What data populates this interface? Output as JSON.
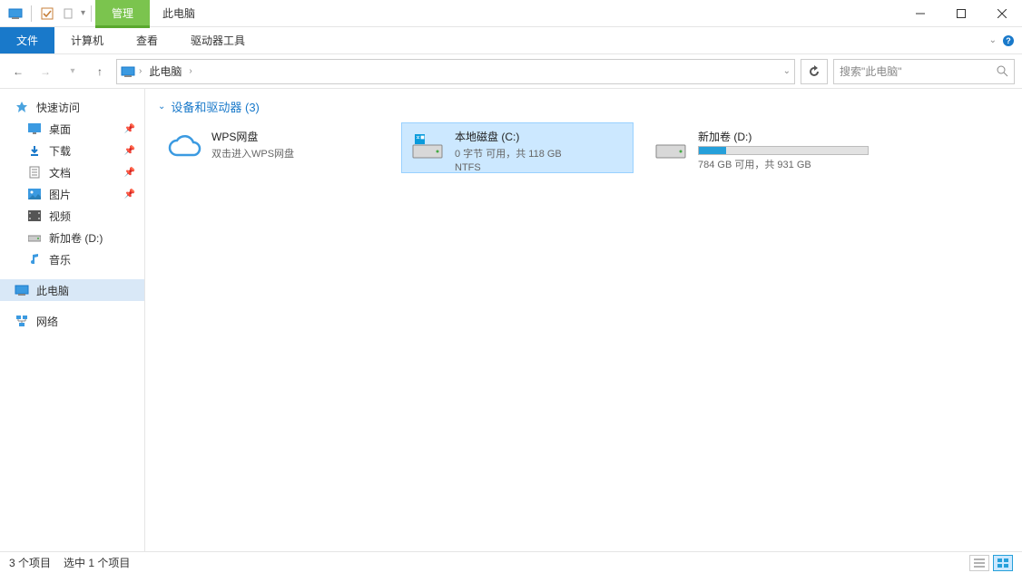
{
  "titlebar": {
    "manage_tab": "管理",
    "title": "此电脑"
  },
  "ribbon": {
    "file": "文件",
    "computer": "计算机",
    "view": "查看",
    "drive_tools": "驱动器工具"
  },
  "nav": {
    "crumb": "此电脑",
    "search_placeholder": "搜索\"此电脑\""
  },
  "sidebar": {
    "quick_access": "快速访问",
    "items": [
      {
        "label": "桌面",
        "pinned": true
      },
      {
        "label": "下载",
        "pinned": true
      },
      {
        "label": "文档",
        "pinned": true
      },
      {
        "label": "图片",
        "pinned": true
      },
      {
        "label": "视频",
        "pinned": false
      },
      {
        "label": "新加卷 (D:)",
        "pinned": false
      },
      {
        "label": "音乐",
        "pinned": false
      }
    ],
    "this_pc": "此电脑",
    "network": "网络"
  },
  "section": {
    "header": "设备和驱动器 (3)"
  },
  "drives": [
    {
      "name": "WPS网盘",
      "sub": "双击进入WPS网盘",
      "type": "cloud"
    },
    {
      "name": "本地磁盘 (C:)",
      "sub": "0 字节 可用，共 118 GB",
      "sub2": "NTFS",
      "type": "disk",
      "selected": true,
      "fill_pct": 0
    },
    {
      "name": "新加卷 (D:)",
      "sub": "784 GB 可用，共 931 GB",
      "type": "disk",
      "fill_pct": 16
    }
  ],
  "status": {
    "count": "3 个项目",
    "selected": "选中 1 个项目"
  }
}
